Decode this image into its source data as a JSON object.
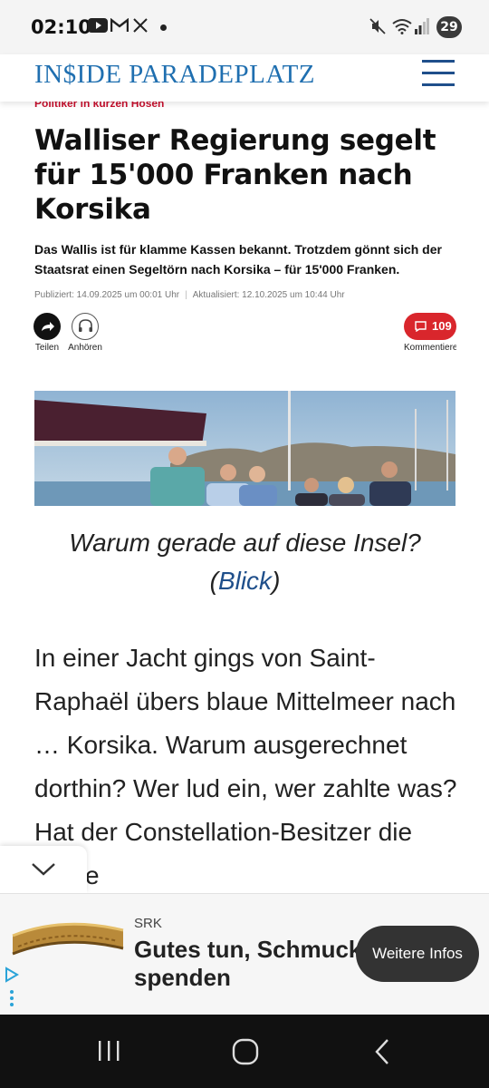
{
  "status_bar": {
    "time": "02:10",
    "battery": "29",
    "icons": [
      "youtube-icon",
      "gmail-icon",
      "x-icon",
      "notification-dot",
      "mute-icon",
      "wifi-icon",
      "signal-icon",
      "battery-icon"
    ]
  },
  "header": {
    "logo": "IN$IDE PARADEPLATZ",
    "menu_icon": "hamburger-menu-icon"
  },
  "article": {
    "kicker": "Politiker in kurzen Hosen",
    "headline": "Walliser Regierung segelt für 15'000 Franken nach Korsika",
    "lead": "Das Wallis ist für klamme Kassen bekannt. Trotzdem gönnt sich der Staatsrat einen Segeltörn nach Korsika – für 15'000 Franken.",
    "published": "Publiziert: 14.09.2025 um 00:01 Uhr",
    "updated": "Aktualisiert: 12.10.2025 um 10:44 Uhr",
    "actions": {
      "share_label": "Teilen",
      "listen_label": "Anhören",
      "comments_count": "109",
      "comments_label": "Kommentiere"
    },
    "caption_text": "Warum gerade auf diese Insel?",
    "caption_open": "(",
    "caption_link": "Blick",
    "caption_close": ")",
    "body": "In einer Jacht gings von Saint-Raphaël übers blaue Mittelmeer nach … Korsika. Warum ausgerechnet dorthin? Wer lud ein, wer zahlte was? Hat der Constellation-Besitzer die Reise"
  },
  "ad": {
    "brand": "SRK",
    "title": "Gutes tun, Schmuck spenden",
    "cta": "Weitere Infos"
  },
  "colors": {
    "logo_blue": "#1f6fb0",
    "kicker_red": "#c8102e",
    "comments_red": "#d9262c",
    "link_blue": "#1f4f8b"
  }
}
